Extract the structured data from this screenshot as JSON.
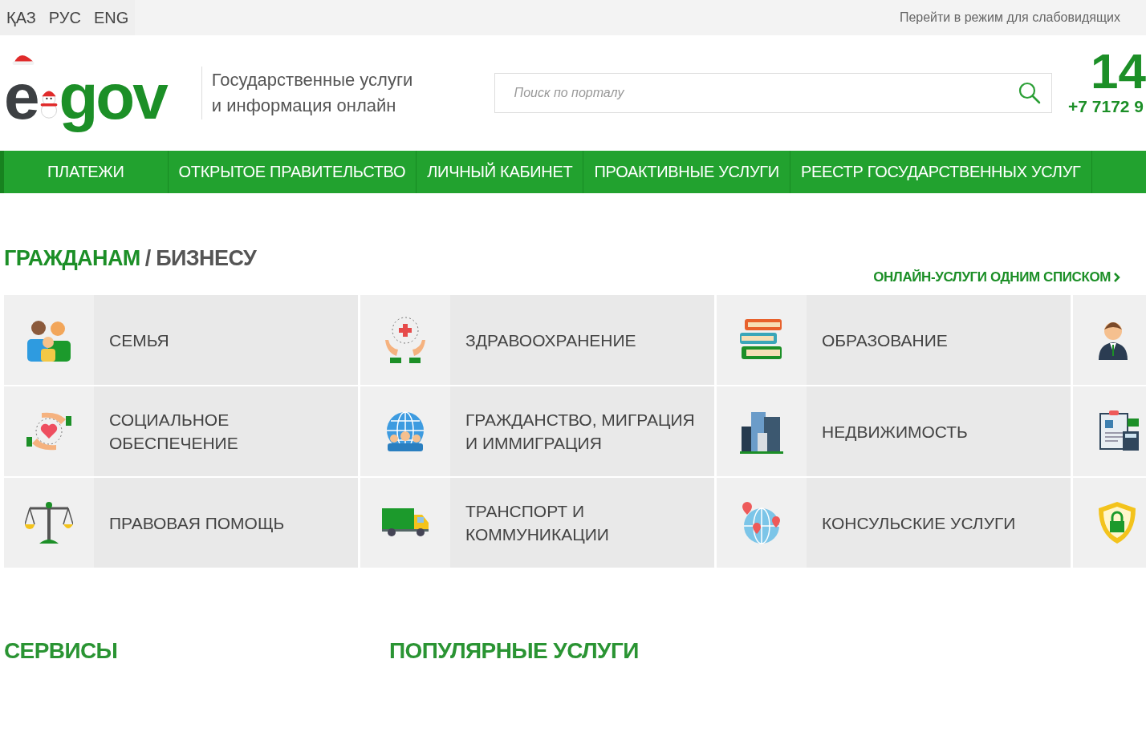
{
  "top_bar": {
    "languages": [
      "ҚАЗ",
      "РУС",
      "ENG"
    ],
    "accessibility_link": "Перейти в режим для слабовидящих"
  },
  "header": {
    "logo": {
      "prefix": "e",
      "name": "gov"
    },
    "tagline": [
      "Государственные услуги",
      "и информация онлайн"
    ],
    "search": {
      "placeholder": "Поиск по порталу"
    },
    "contact": {
      "short_number": "14",
      "phone": "+7 7172 9"
    }
  },
  "nav": [
    "ПЛАТЕЖИ",
    "ОТКРЫТОЕ ПРАВИТЕЛЬСТВО",
    "ЛИЧНЫЙ КАБИНЕТ",
    "ПРОАКТИВНЫЕ УСЛУГИ",
    "РЕЕСТР ГОСУДАРСТВЕННЫХ УСЛУГ"
  ],
  "audience_tabs": {
    "tabs": [
      {
        "label": "ГРАЖДАНАМ",
        "selected": true
      },
      {
        "label": "БИЗНЕСУ",
        "selected": false
      }
    ],
    "separator": "/"
  },
  "all_services_link": "ОНЛАЙН-УСЛУГИ ОДНИМ СПИСКОМ",
  "categories": [
    {
      "kind": "labeled",
      "label": "СЕМЬЯ"
    },
    {
      "kind": "labeled",
      "label": "ЗДРАВООХРАНЕНИЕ"
    },
    {
      "kind": "labeled",
      "label": "ОБРАЗОВАНИЕ"
    },
    {
      "kind": "icon_only"
    },
    {
      "kind": "labeled",
      "label": "СОЦИАЛЬНОЕ ОБЕСПЕЧЕНИЕ"
    },
    {
      "kind": "labeled",
      "label": "ГРАЖДАНСТВО, МИГРАЦИЯ И ИММИГРАЦИЯ"
    },
    {
      "kind": "labeled",
      "label": "НЕДВИЖИМОСТЬ"
    },
    {
      "kind": "icon_only"
    },
    {
      "kind": "labeled",
      "label": "ПРАВОВАЯ ПОМОЩЬ"
    },
    {
      "kind": "labeled",
      "label": "ТРАНСПОРТ И КОММУНИКАЦИИ"
    },
    {
      "kind": "labeled",
      "label": "КОНСУЛЬСКИЕ УСЛУГИ"
    },
    {
      "kind": "icon_only"
    }
  ],
  "bottom_headings": [
    "СЕРВИСЫ",
    "ПОПУЛЯРНЫЕ УСЛУГИ"
  ]
}
